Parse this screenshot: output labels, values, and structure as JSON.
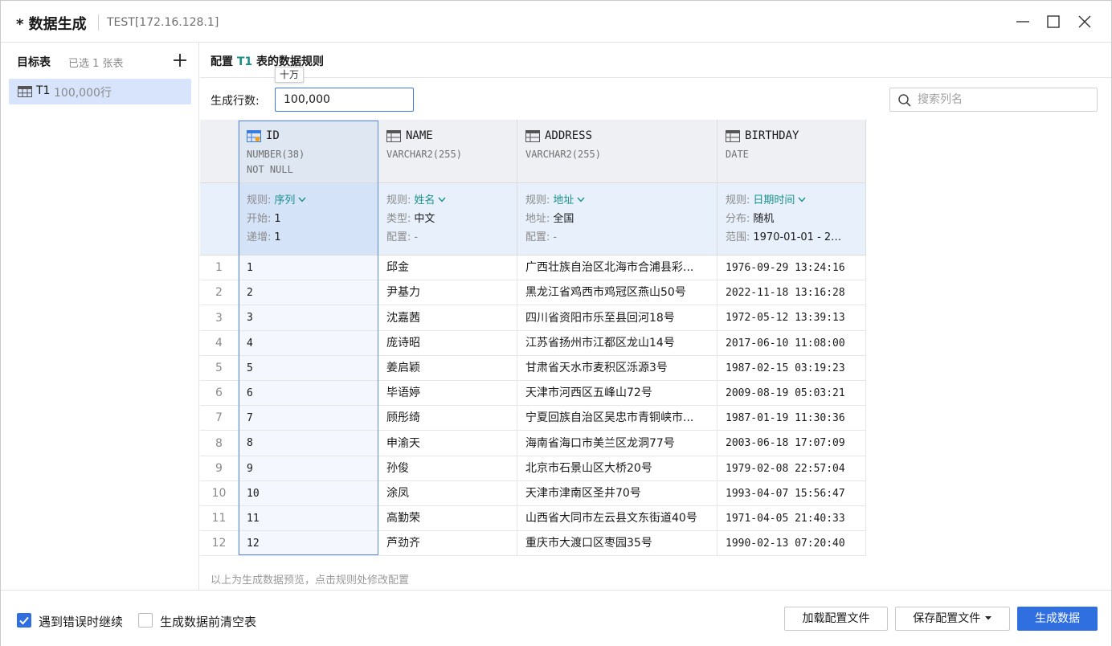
{
  "window": {
    "title": "* 数据生成",
    "connection": "TEST[172.16.128.1]"
  },
  "sidebar": {
    "heading": "目标表",
    "selected_count": "已选 1 张表",
    "items": [
      {
        "name": "T1",
        "rows": "100,000行",
        "icon": "table-icon"
      }
    ]
  },
  "config": {
    "title_prefix": "配置",
    "table_name": "T1",
    "title_suffix": "表的数据规则",
    "rows_label": "生成行数:",
    "rows_value": "100,000",
    "rows_tooltip": "十万",
    "search_placeholder": "搜索列名"
  },
  "columns": [
    {
      "name": "ID",
      "type": "NUMBER(38)",
      "constraint": "NOT NULL",
      "icon": "primary-key-column-icon",
      "rule_label": "规则:",
      "rule": "序列",
      "p1_label": "开始:",
      "p1_value": "1",
      "p2_label": "递增:",
      "p2_value": "1"
    },
    {
      "name": "NAME",
      "type": "VARCHAR2(255)",
      "constraint": "",
      "icon": "column-icon",
      "rule_label": "规则:",
      "rule": "姓名",
      "p1_label": "类型:",
      "p1_value": "中文",
      "p2_label": "配置:",
      "p2_value": "-"
    },
    {
      "name": "ADDRESS",
      "type": "VARCHAR2(255)",
      "constraint": "",
      "icon": "column-icon",
      "rule_label": "规则:",
      "rule": "地址",
      "p1_label": "地址:",
      "p1_value": "全国",
      "p2_label": "配置:",
      "p2_value": "-"
    },
    {
      "name": "BIRTHDAY",
      "type": "DATE",
      "constraint": "",
      "icon": "column-icon",
      "rule_label": "规则:",
      "rule": "日期时间",
      "p1_label": "分布:",
      "p1_value": "随机",
      "p2_label": "范围:",
      "p2_value": "1970-01-01 - 202..."
    }
  ],
  "rows": [
    {
      "n": "1",
      "id": "1",
      "name": "邱金",
      "address": "广西壮族自治区北海市合浦县彩...",
      "birthday": "1976-09-29 13:24:16"
    },
    {
      "n": "2",
      "id": "2",
      "name": "尹基力",
      "address": "黑龙江省鸡西市鸡冠区燕山50号",
      "birthday": "2022-11-18 13:16:28"
    },
    {
      "n": "3",
      "id": "3",
      "name": "沈嘉茜",
      "address": "四川省资阳市乐至县回河18号",
      "birthday": "1972-05-12 13:39:13"
    },
    {
      "n": "4",
      "id": "4",
      "name": "庞诗昭",
      "address": "江苏省扬州市江都区龙山14号",
      "birthday": "2017-06-10 11:08:00"
    },
    {
      "n": "5",
      "id": "5",
      "name": "姜启颖",
      "address": "甘肃省天水市麦积区泺源3号",
      "birthday": "1987-02-15 03:19:23"
    },
    {
      "n": "6",
      "id": "6",
      "name": "毕语婷",
      "address": "天津市河西区五峰山72号",
      "birthday": "2009-08-19 05:03:21"
    },
    {
      "n": "7",
      "id": "7",
      "name": "顾彤绮",
      "address": "宁夏回族自治区吴忠市青铜峡市...",
      "birthday": "1987-01-19 11:30:36"
    },
    {
      "n": "8",
      "id": "8",
      "name": "申渝天",
      "address": "海南省海口市美兰区龙洞77号",
      "birthday": "2003-06-18 17:07:09"
    },
    {
      "n": "9",
      "id": "9",
      "name": "孙俊",
      "address": "北京市石景山区大桥20号",
      "birthday": "1979-02-08 22:57:04"
    },
    {
      "n": "10",
      "id": "10",
      "name": "涂凤",
      "address": "天津市津南区圣井70号",
      "birthday": "1993-04-07 15:56:47"
    },
    {
      "n": "11",
      "id": "11",
      "name": "高勤荣",
      "address": "山西省大同市左云县文东街道40号",
      "birthday": "1971-04-05 21:40:33"
    },
    {
      "n": "12",
      "id": "12",
      "name": "芦劲齐",
      "address": "重庆市大渡口区枣园35号",
      "birthday": "1990-02-13 07:20:40"
    }
  ],
  "hint": "以上为生成数据预览，点击规则处修改配置",
  "footer": {
    "continue_on_error": {
      "label": "遇到错误时继续",
      "checked": true
    },
    "truncate_before": {
      "label": "生成数据前清空表",
      "checked": false
    },
    "load_config": "加载配置文件",
    "save_config": "保存配置文件",
    "generate": "生成数据"
  },
  "colors": {
    "accent": "#2f6fe0",
    "rule_link": "#1a8f8a",
    "selected_item_bg": "#d7e4fb"
  }
}
